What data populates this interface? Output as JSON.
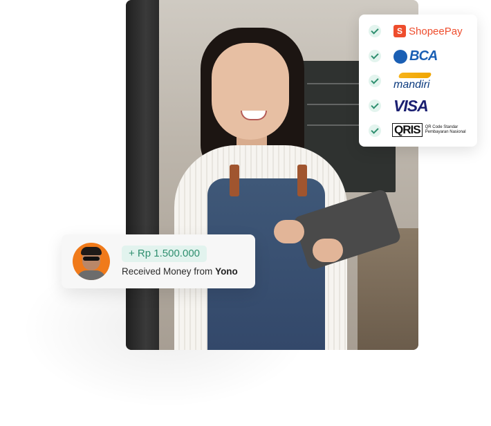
{
  "payment_methods": [
    {
      "name": "ShopeePay",
      "icon": "shopeepay-logo"
    },
    {
      "name": "BCA",
      "icon": "bca-logo"
    },
    {
      "name": "mandiri",
      "icon": "mandiri-logo"
    },
    {
      "name": "VISA",
      "icon": "visa-logo"
    },
    {
      "name": "QRIS",
      "icon": "qris-logo",
      "subtitle": "QR Code Standar Pembayaran Nasional"
    }
  ],
  "transaction": {
    "amount": "+ Rp 1.500.000",
    "text": "Received Money from ",
    "sender": "Yono"
  },
  "colors": {
    "accent_green": "#2f8f6f",
    "badge_bg": "#e2f3ee",
    "shopee": "#ee4d2d",
    "bca": "#1a5fb4",
    "mandiri": "#0b3a7e",
    "visa": "#1a1f71"
  }
}
